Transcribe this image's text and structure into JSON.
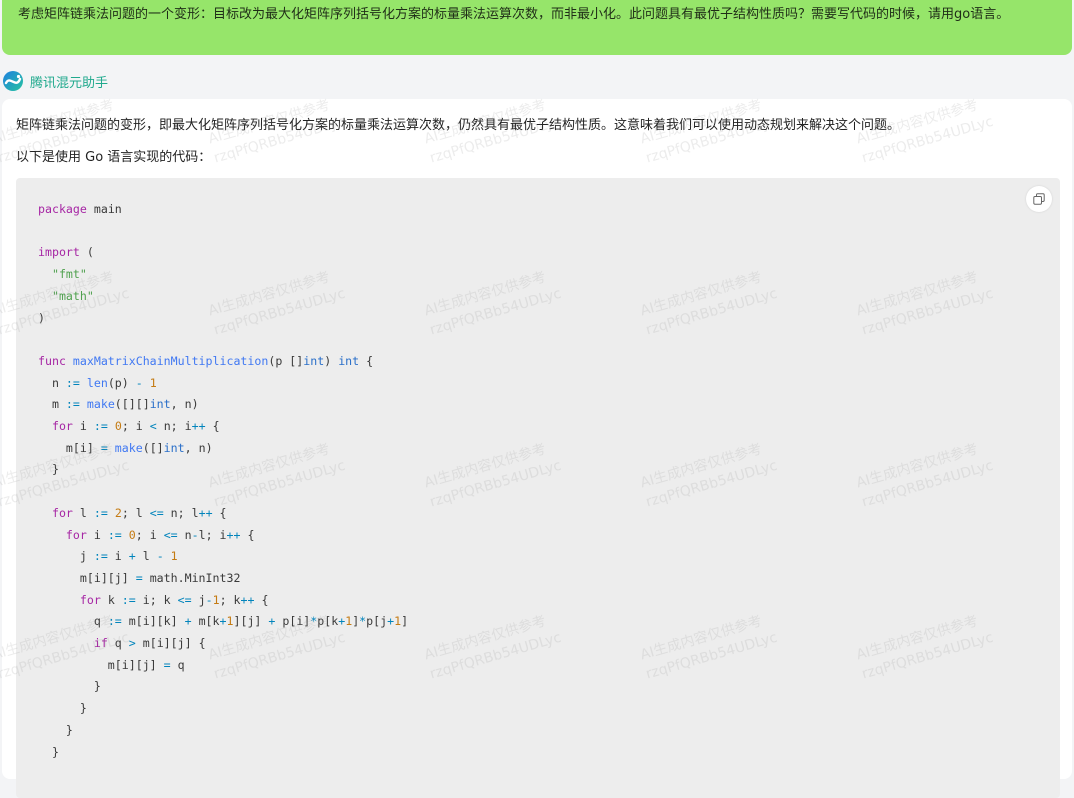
{
  "user_message": "考虑矩阵链乘法问题的一个变形：目标改为最大化矩阵序列括号化方案的标量乘法运算次数，而非最小化。此问题具有最优子结构性质吗？需要写代码的时候，请用go语言。",
  "assistant": {
    "name": "腾讯混元助手",
    "logo_icon": "hunyuan-logo-icon"
  },
  "answer": {
    "paragraphs": [
      "矩阵链乘法问题的变形，即最大化矩阵序列括号化方案的标量乘法运算次数，仍然具有最优子结构性质。这意味着我们可以使用动态规划来解决这个问题。",
      "以下是使用 Go 语言实现的代码："
    ],
    "code_language": "go",
    "copy_icon": "copy-icon",
    "code_lines": [
      "package main",
      "",
      "import (",
      "  \"fmt\"",
      "  \"math\"",
      ")",
      "",
      "func maxMatrixChainMultiplication(p []int) int {",
      "  n := len(p) - 1",
      "  m := make([][]int, n)",
      "  for i := 0; i < n; i++ {",
      "    m[i] = make([]int, n)",
      "  }",
      "",
      "  for l := 2; l <= n; l++ {",
      "    for i := 0; i <= n-l; i++ {",
      "      j := i + l - 1",
      "      m[i][j] = math.MinInt32",
      "      for k := i; k <= j-1; k++ {",
      "        q := m[i][k] + m[k+1][j] + p[i]*p[k+1]*p[j+1]",
      "        if q > m[i][j] {",
      "          m[i][j] = q",
      "        }",
      "      }",
      "    }",
      "  }"
    ]
  },
  "watermark": {
    "line1": "AI生成内容仅供参考",
    "line2": "rzqPfQRBb54UDLyc"
  },
  "colors": {
    "user_bubble": "#96e56a",
    "page_background": "#f3f4f6",
    "code_background": "#ededed",
    "assistant_name": "#20a98d",
    "keyword": "#a626a4",
    "string": "#50a14f",
    "number": "#c47a12",
    "function": "#4078f2",
    "type": "#2a6fc9",
    "operator": "#0184bc"
  }
}
